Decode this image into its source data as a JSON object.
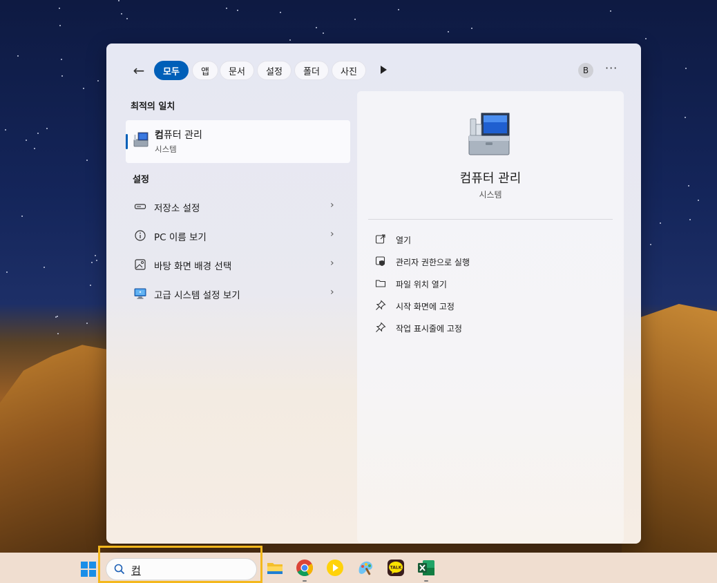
{
  "top_bar": {
    "back_label": "←",
    "filters": [
      "모두",
      "앱",
      "문서",
      "설정",
      "폴더",
      "사진"
    ],
    "active_filter": "모두",
    "avatar_letter": "B",
    "more_label": "···"
  },
  "best_match": {
    "section_title": "최적의 일치",
    "name_bold": "컴",
    "name_rest": "퓨터 관리",
    "subtitle": "시스템"
  },
  "settings": {
    "section_title": "설정",
    "items": [
      {
        "label": "저장소 설정",
        "icon": "storage-icon"
      },
      {
        "label": "PC 이름 보기",
        "icon": "info-icon"
      },
      {
        "label": "바탕 화면 배경 선택",
        "icon": "picture-icon"
      },
      {
        "label": "고급 시스템 설정 보기",
        "icon": "monitor-icon"
      }
    ],
    "chevron": "›"
  },
  "details": {
    "title": "컴퓨터 관리",
    "subtitle": "시스템",
    "actions": [
      {
        "label": "열기",
        "icon": "open-external-icon"
      },
      {
        "label": "관리자 권한으로 실행",
        "icon": "shield-icon"
      },
      {
        "label": "파일 위치 열기",
        "icon": "folder-icon"
      },
      {
        "label": "시작 화면에 고정",
        "icon": "pin-icon"
      },
      {
        "label": "작업 표시줄에 고정",
        "icon": "pin-icon"
      }
    ]
  },
  "taskbar": {
    "search_value": "컴",
    "apps": [
      "file-explorer-icon",
      "chrome-icon",
      "media-player-icon",
      "paint-icon",
      "kakaotalk-icon",
      "excel-icon"
    ],
    "kakao_label": "TALK"
  },
  "colors": {
    "accent": "#005fb8",
    "highlight": "#f4b81d",
    "windows_blue": "#1a8ee8"
  }
}
